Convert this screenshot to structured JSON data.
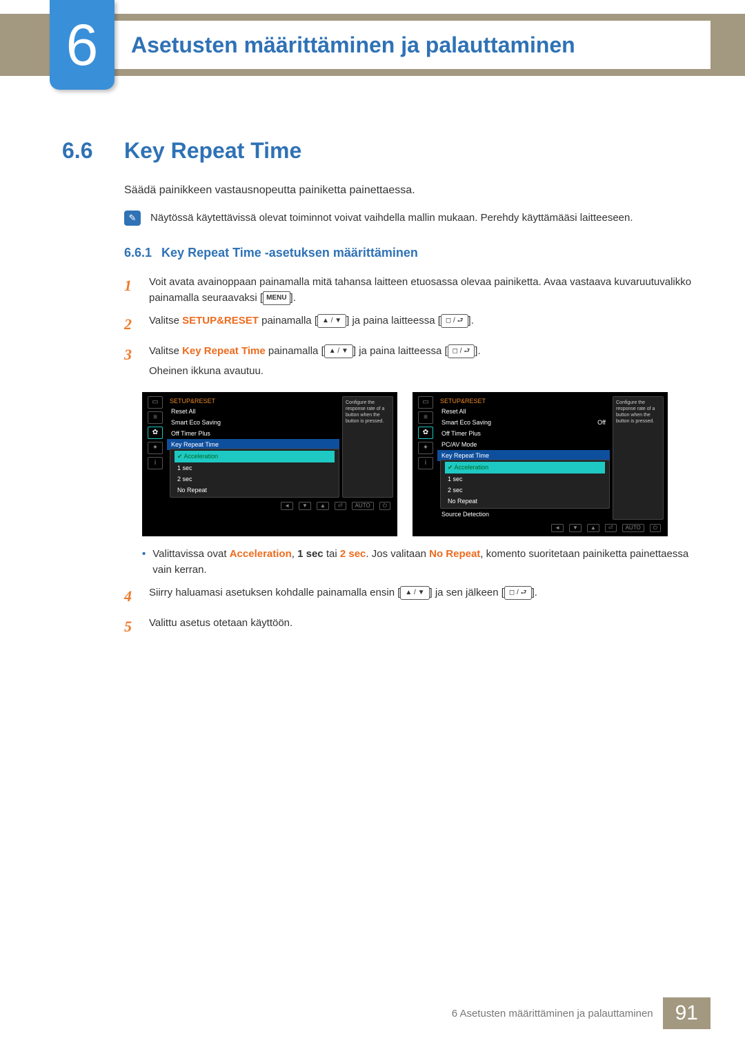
{
  "chapter": {
    "number": "6",
    "title": "Asetusten määrittäminen ja palauttaminen"
  },
  "section": {
    "number": "6.6",
    "title": "Key Repeat Time"
  },
  "intro": "Säädä painikkeen vastausnopeutta painiketta painettaessa.",
  "note": "Näytössä käytettävissä olevat toiminnot voivat vaihdella mallin mukaan. Perehdy käyttämääsi laitteeseen.",
  "subsection": {
    "number": "6.6.1",
    "title": "Key Repeat Time -asetuksen määrittäminen"
  },
  "steps": {
    "s1": {
      "text_a": "Voit avata avainoppaan painamalla mitä tahansa laitteen etuosassa olevaa painiketta. Avaa vastaava kuvaruutuvalikko painamalla seuraavaksi [",
      "menu": "MENU",
      "text_b": "]."
    },
    "s2": {
      "pre": "Valitse ",
      "kw": "SETUP&RESET",
      "mid1": " painamalla [",
      "arrows": "▲ / ▼",
      "mid2": "] ja paina laitteessa [",
      "btn": "◻ / ⮐",
      "end": "]."
    },
    "s3": {
      "pre": "Valitse ",
      "kw": "Key Repeat Time",
      "mid1": " painamalla [",
      "arrows": "▲ / ▼",
      "mid2": "] ja paina laitteessa [",
      "btn": "◻ / ⮐",
      "end": "].",
      "tail": "Oheinen ikkuna avautuu."
    },
    "s4": {
      "pre": "Siirry haluamasi asetuksen kohdalle painamalla ensin [",
      "arrows": "▲ / ▼",
      "mid": "] ja sen jälkeen [",
      "btn": "◻ / ⮐",
      "end": "]."
    },
    "s5": "Valittu asetus otetaan käyttöön."
  },
  "bullet": {
    "pre": "Valittavissa ovat ",
    "o1": "Acceleration",
    "sep1": ", ",
    "o2": "1 sec",
    "sep2": " tai ",
    "o3": "2 sec",
    "sep3": ". Jos valitaan ",
    "o4": "No Repeat",
    "tail": ", komento suoritetaan painiketta painettaessa vain kerran."
  },
  "osd": {
    "head": "SETUP&RESET",
    "menu1": [
      "Reset All",
      "Smart Eco Saving",
      "Off Timer Plus",
      "Key Repeat Time"
    ],
    "menu2": [
      "Reset All",
      "Smart Eco Saving",
      "Off Timer Plus",
      "PC/AV Mode",
      "Key Repeat Time",
      "Source Detection"
    ],
    "off": "Off",
    "opts": [
      "Acceleration",
      "1 sec",
      "2 sec",
      "No Repeat"
    ],
    "help": "Configure the response rate of a button when the button is pressed.",
    "footer": [
      "◄",
      "▼",
      "▲",
      "⏎",
      "AUTO",
      "⏻"
    ]
  },
  "footer": {
    "text": "6 Asetusten määrittäminen ja palauttaminen",
    "page": "91"
  }
}
